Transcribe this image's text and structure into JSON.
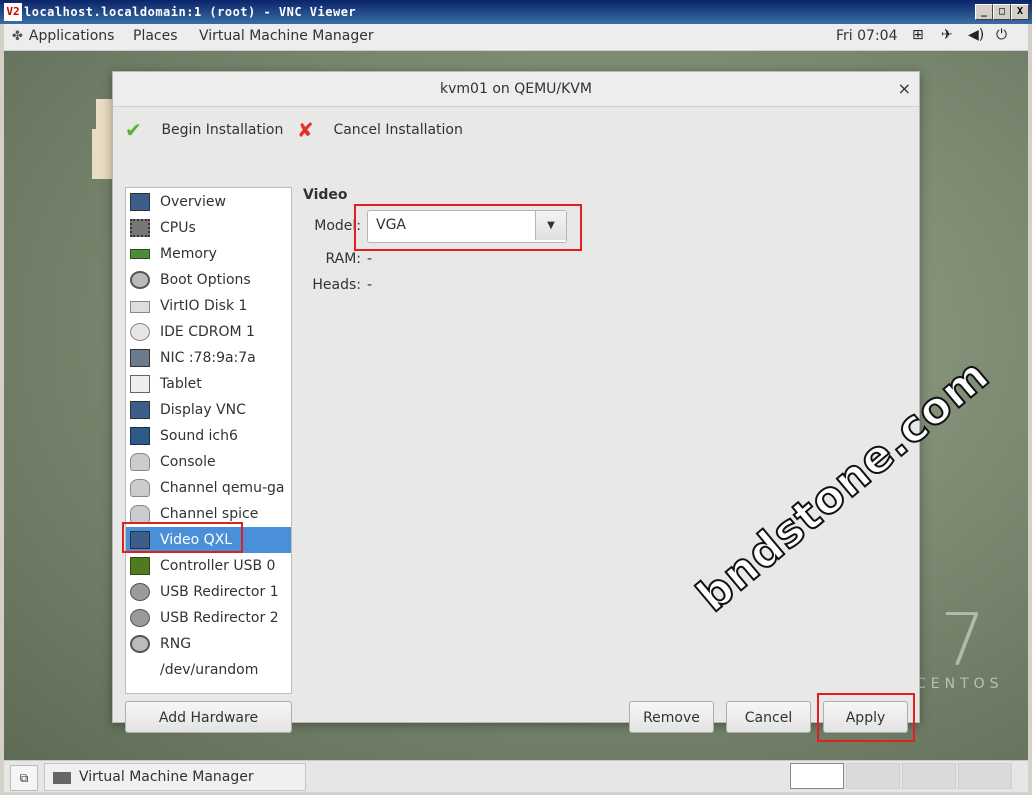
{
  "vnc": {
    "title": "localhost.localdomain:1 (root) - VNC Viewer",
    "logo": "V2",
    "controls": [
      "_",
      "□",
      "X"
    ]
  },
  "topbar": {
    "applications": "Applications",
    "places": "Places",
    "vmm": "Virtual Machine Manager",
    "clock": "Fri 07:04"
  },
  "desktop": {
    "centos_number": "7",
    "centos_word": "CENTOS"
  },
  "dialog": {
    "title": "kvm01 on QEMU/KVM",
    "close": "×",
    "begin_installation": "Begin Installation",
    "cancel_installation": "Cancel Installation",
    "sidebar": [
      {
        "label": "Overview",
        "icon": "monitor-icon"
      },
      {
        "label": "CPUs",
        "icon": "cpu-icon"
      },
      {
        "label": "Memory",
        "icon": "memory-icon"
      },
      {
        "label": "Boot Options",
        "icon": "gear-icon"
      },
      {
        "label": "VirtIO Disk 1",
        "icon": "disk-icon"
      },
      {
        "label": "IDE CDROM 1",
        "icon": "cdrom-icon"
      },
      {
        "label": "NIC :78:9a:7a",
        "icon": "network-icon"
      },
      {
        "label": "Tablet",
        "icon": "tablet-icon"
      },
      {
        "label": "Display VNC",
        "icon": "display-icon"
      },
      {
        "label": "Sound ich6",
        "icon": "sound-icon"
      },
      {
        "label": "Console",
        "icon": "console-icon"
      },
      {
        "label": "Channel qemu-ga",
        "icon": "channel-icon"
      },
      {
        "label": "Channel spice",
        "icon": "channel-icon"
      },
      {
        "label": "Video QXL",
        "icon": "video-icon",
        "selected": true
      },
      {
        "label": "Controller USB 0",
        "icon": "usb-controller-icon"
      },
      {
        "label": "USB Redirector 1",
        "icon": "usb-icon"
      },
      {
        "label": "USB Redirector 2",
        "icon": "usb-icon"
      },
      {
        "label": "RNG /dev/urandom",
        "icon": "gear-icon"
      }
    ],
    "details": {
      "section_title": "Video",
      "model_label": "Model:",
      "model_value": "VGA",
      "ram_label": "RAM:",
      "ram_value": "-",
      "heads_label": "Heads:",
      "heads_value": "-"
    },
    "buttons": {
      "add_hardware": "Add Hardware",
      "remove": "Remove",
      "cancel": "Cancel",
      "apply": "Apply"
    }
  },
  "watermark": "bndstone.com",
  "taskbar": {
    "item": "Virtual Machine Manager"
  },
  "colors": {
    "selection": "#4a90d9",
    "highlight": "#e02020"
  }
}
